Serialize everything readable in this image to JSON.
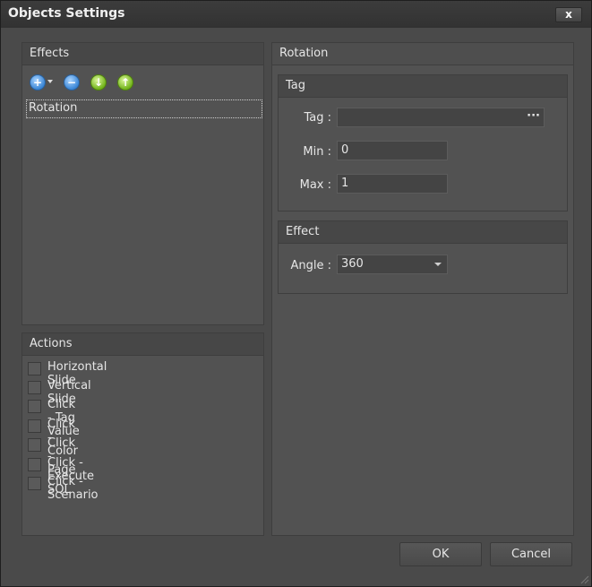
{
  "window": {
    "title": "Objects Settings",
    "close_label": "x"
  },
  "effects": {
    "header": "Effects",
    "items": [
      "Rotation"
    ]
  },
  "actions": {
    "header": "Actions",
    "items": [
      "Horizontal Slide",
      "Vertical Slide",
      "Click - Tag Value",
      "Click - Color",
      "Click - Page",
      "Click - Execute SQL",
      "Click - Scenario"
    ]
  },
  "rotation": {
    "header": "Rotation",
    "tag_group": {
      "header": "Tag",
      "tag_label": "Tag :",
      "tag_value": "",
      "browse_label": "···",
      "min_label": "Min :",
      "min_value": "0",
      "max_label": "Max :",
      "max_value": "1"
    },
    "effect_group": {
      "header": "Effect",
      "angle_label": "Angle :",
      "angle_value": "360"
    }
  },
  "buttons": {
    "ok": "OK",
    "cancel": "Cancel"
  },
  "icons": [
    "add-icon",
    "dropdown-arrow-icon",
    "remove-icon",
    "move-down-icon",
    "move-up-icon"
  ]
}
